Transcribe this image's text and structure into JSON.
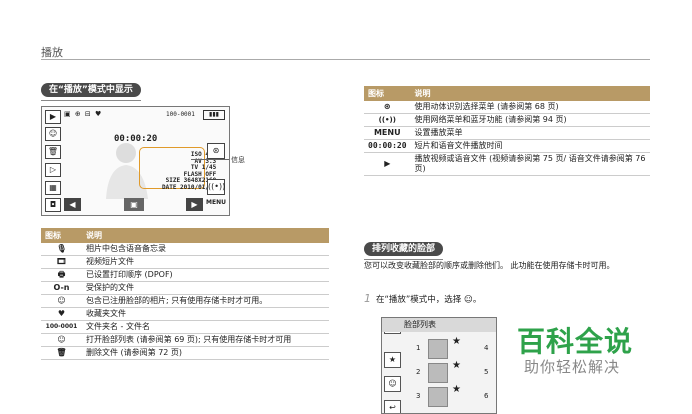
{
  "header": {
    "title": "播放"
  },
  "left_section": {
    "pill": "在“播放”模式中显示",
    "screen": {
      "top_icons": "▣ ⊕ ⊟ ♥",
      "file_no": "100-0001",
      "time": "00:00:20",
      "info_lines": [
        "ISO 400",
        "AV 3.3",
        "TV 1/45",
        "FLASH OFF",
        "SIZE 3648X2160",
        "DATE 2010/01/01"
      ],
      "menu": "MENU",
      "callout": "信息"
    },
    "table": {
      "headers": [
        "图标",
        "说明"
      ],
      "rows": [
        {
          "icon": "🎙",
          "text": "相片中包含语音备忘录"
        },
        {
          "icon": "🎞",
          "text": "视频短片文件"
        },
        {
          "icon": "🖶",
          "text": "已设置打印顺序 (DPOF)"
        },
        {
          "icon": "O-n",
          "text": "受保护的文件"
        },
        {
          "icon": "☺",
          "text": "包含已注册脸部的相片; 只有使用存储卡时才可用。"
        },
        {
          "icon": "♥",
          "text": "收藏夹文件"
        },
        {
          "icon": "100-0001",
          "text": "文件夹名 - 文件名"
        },
        {
          "icon": "☺",
          "text": "打开脸部列表 (请参阅第 69 页); 只有使用存储卡时才可用"
        },
        {
          "icon": "🗑",
          "text": "删除文件 (请参阅第 72 页)"
        }
      ]
    }
  },
  "right_section": {
    "table": {
      "headers": [
        "图标",
        "说明"
      ],
      "rows": [
        {
          "icon": "⊛",
          "text": "使用动体识别选择菜单 (请参阅第 68 页)"
        },
        {
          "icon": "((•))",
          "text": "使用网络菜单和蓝牙功能 (请参阅第 94 页)"
        },
        {
          "icon": "MENU",
          "text": "设置播放菜单"
        },
        {
          "icon": "00:00:20",
          "text": "短片和语音文件播放时间"
        },
        {
          "icon": "▶",
          "text": "播放视频或语音文件 (视频请参阅第 75 页/ 语音文件请参阅第 76 页)"
        }
      ]
    },
    "pill": "排列收藏的脸部",
    "description": "您可以改变收藏脸部的顺序或删除他们。 此功能在使用存储卡时可用。",
    "step": {
      "number": "1",
      "text": "在“播放”模式中，选择 ☺。"
    },
    "face_list": {
      "title": "脸部列表",
      "rows": [
        {
          "n": "1",
          "n2": "4"
        },
        {
          "n": "2",
          "n2": "5"
        },
        {
          "n": "3",
          "n2": "6"
        }
      ]
    }
  },
  "watermark": {
    "line1": "百科全说",
    "line2": "助你轻松解决"
  }
}
